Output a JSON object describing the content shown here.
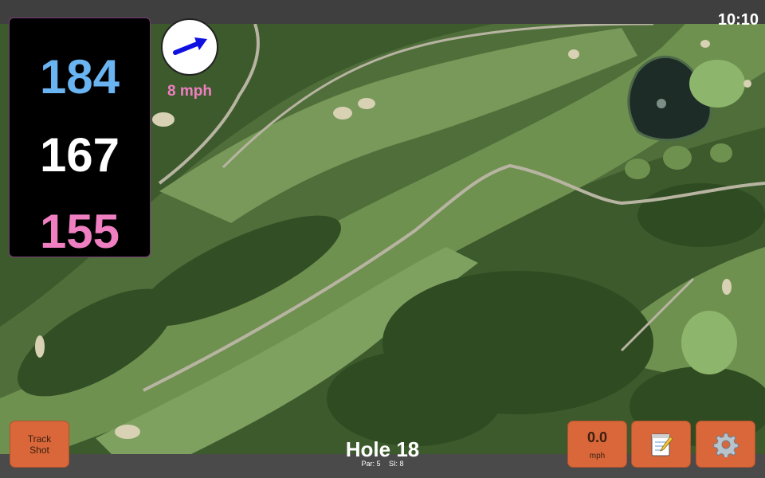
{
  "status": {
    "time": "10:10"
  },
  "distances": {
    "back": "184",
    "middle": "167",
    "front": "155",
    "colors": {
      "back": "#6ab4f2",
      "middle": "#ffffff",
      "front": "#f07fc2"
    }
  },
  "wind": {
    "speed": "8 mph",
    "arrow_color": "#1010e0",
    "speed_color": "#f07fc2",
    "icon": "wind-direction-arrow-icon"
  },
  "hole": {
    "title": "Hole 18",
    "par": "Par: 5",
    "si": "SI: 8"
  },
  "buttons": {
    "track_shot": "Track\nShot",
    "speed_value": "0.0",
    "speed_unit": "mph",
    "notes_icon": "notepad-icon",
    "settings_icon": "gear-icon",
    "accent": "#d9673a"
  },
  "map": {
    "label": "satellite-course-map"
  }
}
